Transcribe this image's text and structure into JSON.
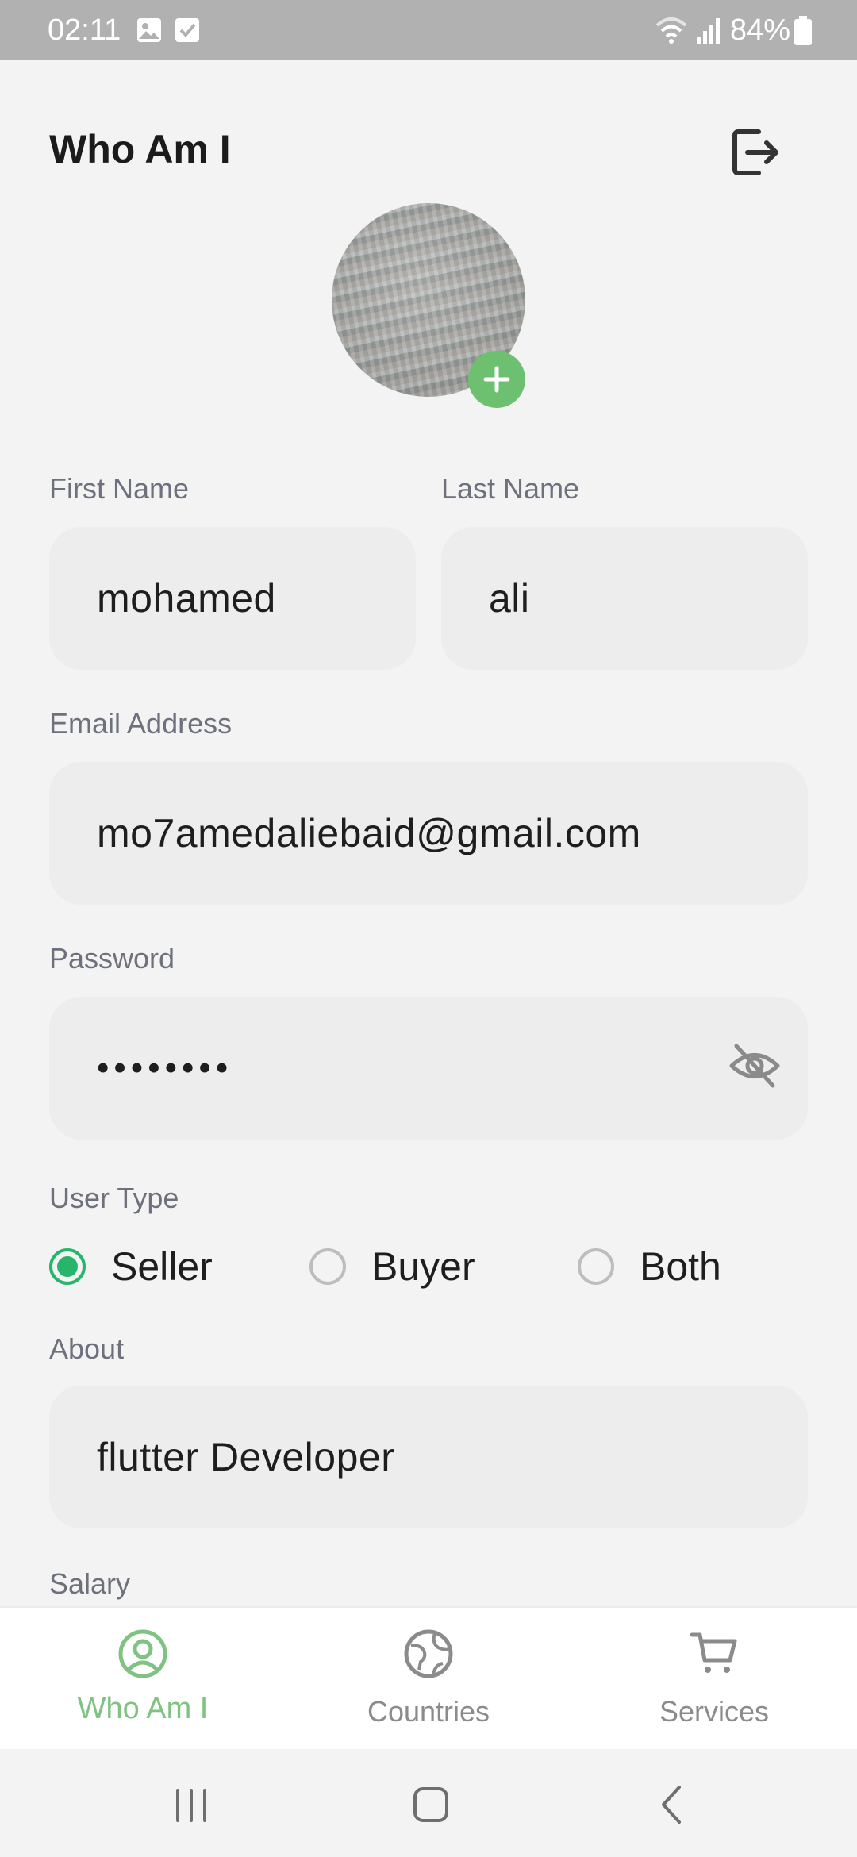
{
  "status_bar": {
    "time": "02:11",
    "battery": "84%",
    "icons": [
      "gallery-notification-icon",
      "check-notification-icon",
      "wifi-icon",
      "signal-icon",
      "battery-icon"
    ]
  },
  "header": {
    "title": "Who Am I",
    "logout_icon": "logout-icon"
  },
  "avatar": {
    "add_icon": "plus-icon"
  },
  "form": {
    "first_name": {
      "label": "First Name",
      "value": "mohamed"
    },
    "last_name": {
      "label": "Last Name",
      "value": "ali"
    },
    "email": {
      "label": "Email Address",
      "value": "mo7amedaliebaid@gmail.com"
    },
    "password": {
      "label": "Password",
      "value": "••••••••",
      "toggle_icon": "eye-off-icon"
    },
    "user_type": {
      "label": "User Type",
      "options": [
        {
          "label": "Seller",
          "selected": true
        },
        {
          "label": "Buyer",
          "selected": false
        },
        {
          "label": "Both",
          "selected": false
        }
      ]
    },
    "about": {
      "label": "About",
      "value": "flutter Developer"
    },
    "salary": {
      "label": "Salary"
    }
  },
  "bottom_nav": {
    "items": [
      {
        "label": "Who Am I",
        "icon": "user-circle-icon",
        "active": true
      },
      {
        "label": "Countries",
        "icon": "globe-icon",
        "active": false
      },
      {
        "label": "Services",
        "icon": "cart-icon",
        "active": false
      }
    ]
  },
  "system_nav": {
    "icons": [
      "recent-apps-icon",
      "home-icon",
      "back-icon"
    ]
  },
  "colors": {
    "accent_green": "#27b56b",
    "nav_active": "#7fc282",
    "avatar_badge": "#6cc070",
    "input_bg": "#ededed",
    "page_bg": "#f3f3f3",
    "status_bar": "#b1b1b1"
  }
}
